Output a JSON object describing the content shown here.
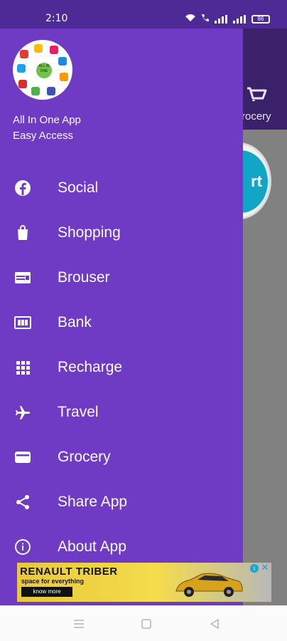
{
  "status_bar": {
    "time": "2:10",
    "battery": "86"
  },
  "background_app": {
    "visible_tab_label": "rocery",
    "visible_button_text": "rt",
    "visible_tab_icon": "cart-icon"
  },
  "drawer": {
    "header": {
      "app_name": "All In One App",
      "subtitle": "Easy Access",
      "logo_text": "ALL IN ONE"
    },
    "items": [
      {
        "label": "Social",
        "icon": "facebook-icon"
      },
      {
        "label": "Shopping",
        "icon": "shopping-bag-icon"
      },
      {
        "label": "Brouser",
        "icon": "browser-icon"
      },
      {
        "label": "Bank",
        "icon": "bank-card-icon"
      },
      {
        "label": "Recharge",
        "icon": "grid-icon"
      },
      {
        "label": "Travel",
        "icon": "airplane-icon"
      },
      {
        "label": "Grocery",
        "icon": "wallet-icon"
      },
      {
        "label": "Share App",
        "icon": "share-icon"
      },
      {
        "label": "About App",
        "icon": "info-icon"
      }
    ]
  },
  "ad": {
    "title": "RENAULT TRIBER",
    "subtitle": "space for everything",
    "cta": "know more"
  },
  "colors": {
    "drawer": "#6f3bc4",
    "status_bar": "#4e2a96",
    "toolbar": "#6c3bc2"
  }
}
